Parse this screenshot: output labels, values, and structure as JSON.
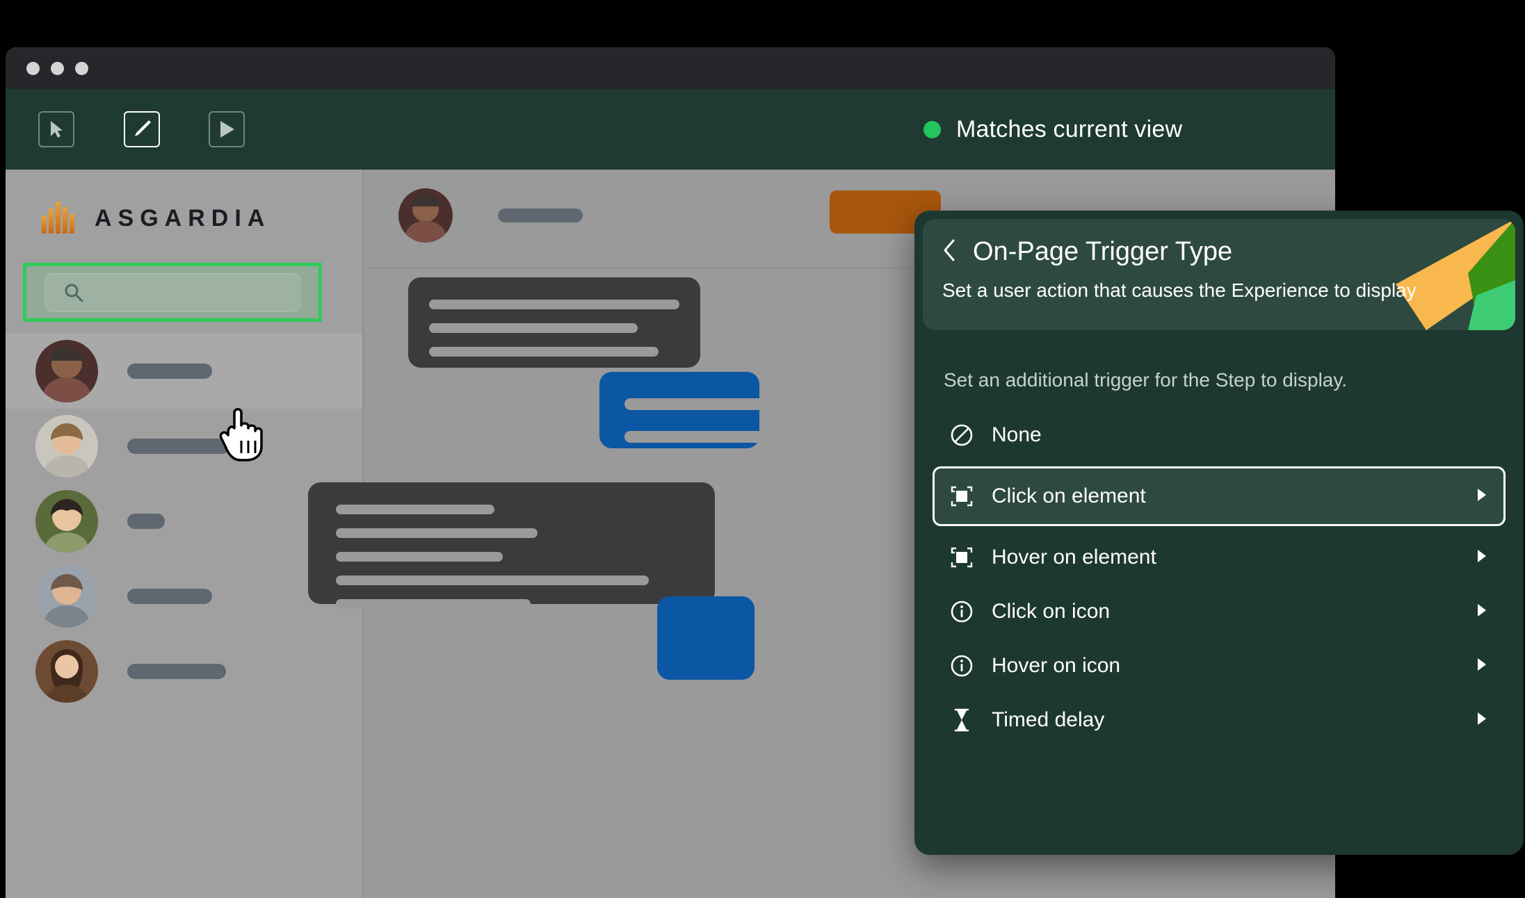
{
  "window": {
    "traffic_lights": [
      "close",
      "minimize",
      "maximize"
    ]
  },
  "toolbar": {
    "buttons": [
      {
        "name": "select-tool",
        "icon": "cursor-icon",
        "active": false
      },
      {
        "name": "edit-tool",
        "icon": "pencil-icon",
        "active": true
      },
      {
        "name": "preview-tool",
        "icon": "play-icon",
        "active": false
      }
    ],
    "status_label": "Matches current view",
    "status_color": "#22C55E"
  },
  "sidebar": {
    "logo_text": "ASGARDIA",
    "logo_colors": [
      "#E8A33D",
      "#D98324",
      "#C96A10"
    ],
    "search": {
      "placeholder": "",
      "value": "",
      "icon": "search-icon",
      "highlight_color": "#2ECC5A"
    },
    "people": [
      {
        "name_width": 122,
        "selected": true
      },
      {
        "name_width": 148,
        "selected": false
      },
      {
        "name_width": 54,
        "selected": false
      },
      {
        "name_width": 122,
        "selected": false
      },
      {
        "name_width": 142,
        "selected": false
      }
    ]
  },
  "main": {
    "post_head_bar_width": 122,
    "cards": [
      {
        "name": "content-card-1",
        "lines": [
          360,
          300,
          330
        ]
      },
      {
        "name": "content-card-2",
        "lines": [
          228,
          290,
          240,
          450,
          280
        ]
      }
    ],
    "blue_cards": [
      {
        "name": "blue-card-1",
        "lines": [
          3
        ]
      },
      {
        "name": "blue-card-2",
        "lines": [
          1
        ]
      }
    ],
    "orange_button": {
      "name": "primary-action-button",
      "color": "#A8560D"
    }
  },
  "panel": {
    "back_icon": "chevron-left-icon",
    "title": "On-Page Trigger Type",
    "subtitle": "Set a user action that causes the Experience to display",
    "description": "Set an additional trigger for the Step to display.",
    "decor_colors": {
      "amber": "#F9B84E",
      "green_dark": "#3A9012",
      "green_bright": "#3DCC74"
    },
    "options": [
      {
        "label": "None",
        "icon": "prohibition-icon",
        "has_arrow": false,
        "selected": false
      },
      {
        "label": "Click on element",
        "icon": "element-frame-icon",
        "has_arrow": true,
        "selected": true
      },
      {
        "label": "Hover on element",
        "icon": "element-frame-icon",
        "has_arrow": true,
        "selected": false
      },
      {
        "label": "Click on icon",
        "icon": "info-circle-icon",
        "has_arrow": true,
        "selected": false
      },
      {
        "label": "Hover on icon",
        "icon": "info-circle-icon",
        "has_arrow": true,
        "selected": false
      },
      {
        "label": "Timed delay",
        "icon": "hourglass-icon",
        "has_arrow": true,
        "selected": false
      }
    ]
  }
}
